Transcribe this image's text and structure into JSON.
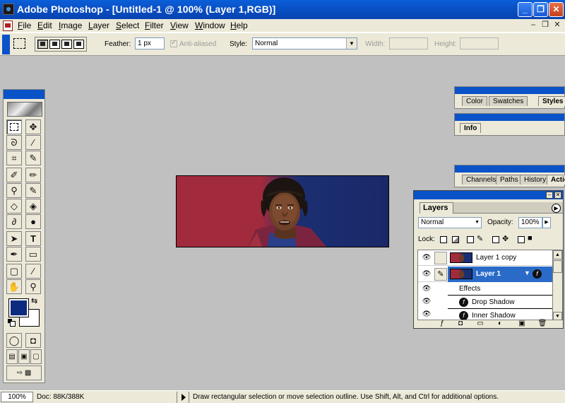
{
  "window": {
    "title": "Adobe Photoshop - [Untitled-1 @ 100% (Layer 1,RGB)]",
    "minimize": "_",
    "restore": "❐",
    "close": "✕"
  },
  "menu": [
    "File",
    "Edit",
    "Image",
    "Layer",
    "Select",
    "Filter",
    "View",
    "Window",
    "Help"
  ],
  "mdi": {
    "minimize": "–",
    "restore": "❐",
    "close": "✕"
  },
  "options": {
    "feather_label": "Feather:",
    "feather_value": "1 px",
    "antialiased_label": "Anti-aliased",
    "style_label": "Style:",
    "style_value": "Normal",
    "width_label": "Width:",
    "height_label": "Height:"
  },
  "palettes": {
    "color_group": [
      "Color",
      "Swatches",
      "Styles"
    ],
    "info_group": [
      "Info"
    ],
    "history_group": [
      "Channels",
      "Paths",
      "History",
      "Actio"
    ]
  },
  "layers": {
    "tab": "Layers",
    "blend_mode": "Normal",
    "opacity_label": "Opacity:",
    "opacity_value": "100%",
    "lock_label": "Lock:",
    "rows": [
      {
        "name": "Layer 1 copy",
        "selected": false
      },
      {
        "name": "Layer 1",
        "selected": true
      }
    ],
    "effects_label": "Effects",
    "effects": [
      "Drop Shadow",
      "Inner Shadow"
    ]
  },
  "status": {
    "zoom": "100%",
    "doc": "Doc: 88K/388K",
    "hint": "Draw rectangular selection or move selection outline.  Use Shift, Alt, and Ctrl for additional options."
  },
  "colors": {
    "foreground": "#0c2a80",
    "background": "#ffffff",
    "title_blue": "#0a52c8"
  }
}
